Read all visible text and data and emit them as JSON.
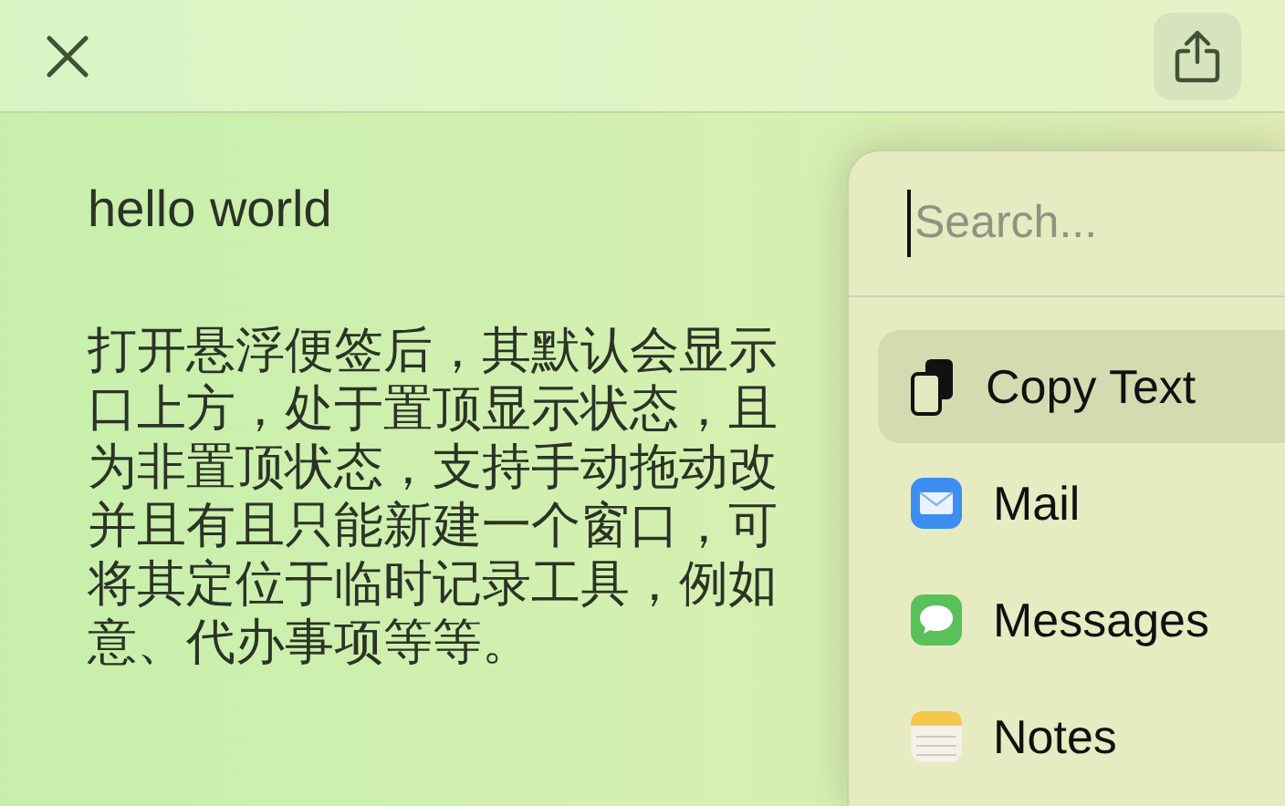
{
  "note": {
    "title": "hello world",
    "lines": [
      "打开悬浮便签后，其默认会显示",
      "口上方，处于置顶显示状态，且",
      "为非置顶状态，支持手动拖动改",
      "并且有且只能新建一个窗口，可",
      "将其定位于临时记录工具，例如",
      "意、代办事项等等。"
    ]
  },
  "share_menu": {
    "search": {
      "placeholder": "Search..."
    },
    "items": [
      {
        "kind": "copy",
        "label": "Copy Text",
        "selected": true
      },
      {
        "kind": "mail",
        "label": "Mail",
        "selected": false
      },
      {
        "kind": "messages",
        "label": "Messages",
        "selected": false
      },
      {
        "kind": "notes",
        "label": "Notes",
        "selected": false
      }
    ]
  }
}
